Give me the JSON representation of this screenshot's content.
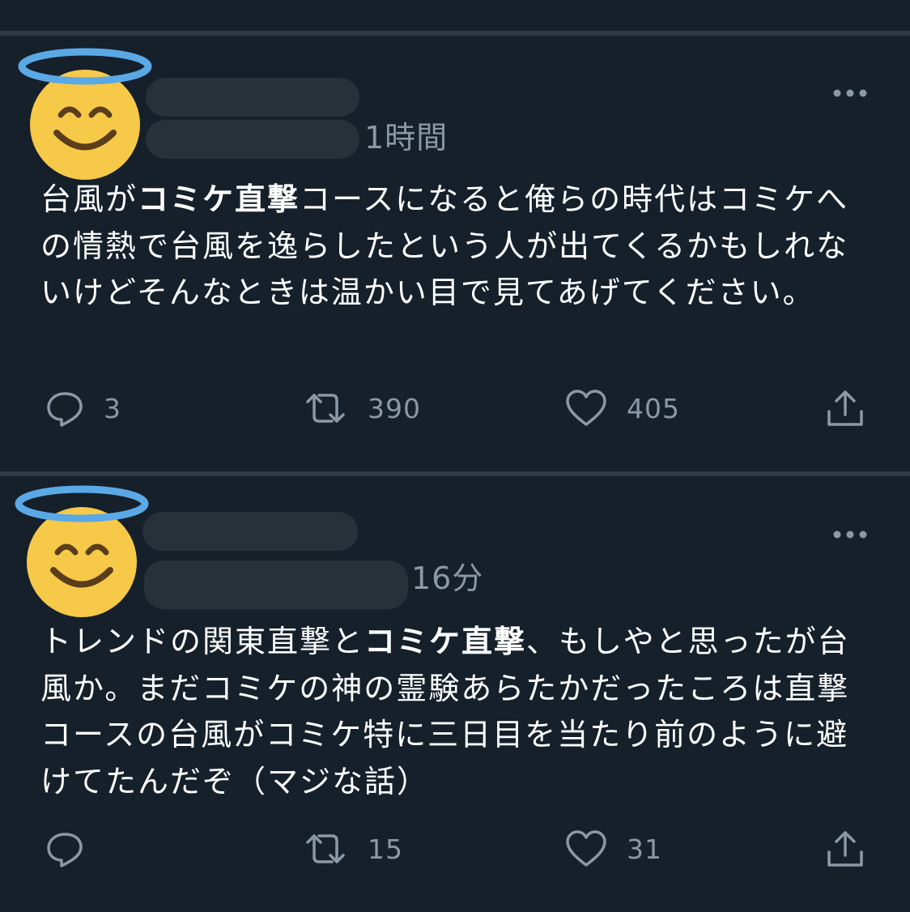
{
  "tweets": [
    {
      "time": "1時間",
      "text_segments": [
        {
          "text": "台風が",
          "bold": false
        },
        {
          "text": "コミケ直撃",
          "bold": true
        },
        {
          "text": "コースになると俺らの時代はコミケへの情熱で台風を逸らしたという人が出てくるかもしれないけどそんなときは温かい目で見てあげてください。",
          "bold": false
        }
      ],
      "reply_count": "3",
      "retweet_count": "390",
      "like_count": "405"
    },
    {
      "time": "16分",
      "text_segments": [
        {
          "text": "トレンドの関東直撃と",
          "bold": false
        },
        {
          "text": "コミケ直撃",
          "bold": true
        },
        {
          "text": "、もしやと思ったが台風か。まだコミケの神の霊験あらたかだったころは直撃コースの台風がコミケ特に三日目を当たり前のように避けてたんだぞ（マジな話）",
          "bold": false
        }
      ],
      "reply_count": "",
      "retweet_count": "15",
      "like_count": "31"
    }
  ],
  "icons": {
    "avatar": "smiling-face-with-halo-emoji",
    "more": "more-dots-icon",
    "reply": "reply-icon",
    "retweet": "retweet-icon",
    "like": "heart-icon",
    "share": "share-icon"
  },
  "colors": {
    "background": "#15202b",
    "divider": "#2f3a45",
    "muted_text": "#8b98a5",
    "redaction": "#283139"
  }
}
